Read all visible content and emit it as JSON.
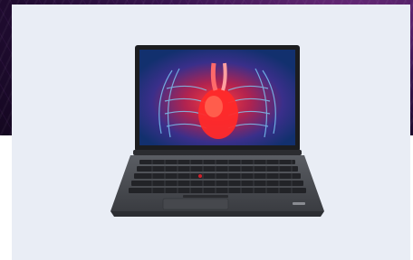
{
  "page": {
    "background_accent": "#2a0f3d",
    "card_color": "#e9edf5"
  },
  "product": {
    "image_icon": "laptop-with-anatomy-screen",
    "screen_theme_colors": [
      "#1a3a8a",
      "#e8303a",
      "#3ec8ff"
    ],
    "body_color": "#4a4d53",
    "trackpoint_color": "#d0202a"
  }
}
